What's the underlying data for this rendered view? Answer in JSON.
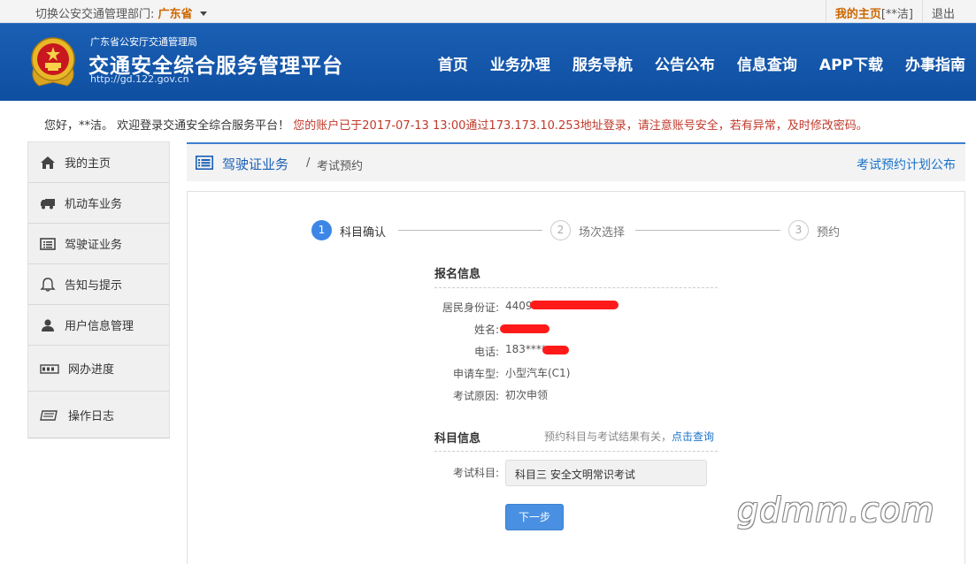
{
  "topbar": {
    "dept_label": "切换公安交通管理部门:",
    "dept_value": "广东省",
    "my_home": "我的主页",
    "user_masked": "[**洁]",
    "logout": "退出"
  },
  "header": {
    "org": "广东省公安厅交通管理局",
    "title": "交通安全综合服务管理平台",
    "url": "http://gd.122.gov.cn",
    "nav": [
      "首页",
      "业务办理",
      "服务导航",
      "公告公布",
      "信息查询",
      "APP下载",
      "办事指南"
    ]
  },
  "welcome": {
    "greeting": "您好，**洁。 欢迎登录交通安全综合服务平台！",
    "warning": "您的账户已于2017-07-13 13:00通过173.173.10.253地址登录，请注意账号安全，若有异常，及时修改密码。"
  },
  "sidebar": {
    "items": [
      {
        "label": "我的主页",
        "icon": "home-icon"
      },
      {
        "label": "机动车业务",
        "icon": "truck-icon"
      },
      {
        "label": "驾驶证业务",
        "icon": "license-card-icon"
      },
      {
        "label": "告知与提示",
        "icon": "bell-icon"
      },
      {
        "label": "用户信息管理",
        "icon": "user-icon"
      },
      {
        "label": "网办进度",
        "icon": "progress-icon"
      },
      {
        "label": "操作日志",
        "icon": "log-icon"
      }
    ]
  },
  "breadcrumb": {
    "section": "驾驶证业务",
    "separator": "/",
    "page": "考试预约",
    "plan_link": "考试预约计划公布"
  },
  "steps": [
    {
      "num": "1",
      "label": "科目确认",
      "active": true
    },
    {
      "num": "2",
      "label": "场次选择",
      "active": false
    },
    {
      "num": "3",
      "label": "预约",
      "active": false
    }
  ],
  "registration": {
    "title": "报名信息",
    "fields": [
      {
        "label": "居民身份证:",
        "value": "4409"
      },
      {
        "label": "姓名:",
        "value": ""
      },
      {
        "label": "电话:",
        "value": "183****"
      },
      {
        "label": "申请车型:",
        "value": "小型汽车(C1)"
      },
      {
        "label": "考试原因:",
        "value": "初次申领"
      }
    ]
  },
  "subject": {
    "title": "科目信息",
    "hint": "预约科目与考试结果有关，",
    "hint_link": "点击查询",
    "label": "考试科目:",
    "value": "科目三 安全文明常识考试",
    "next_button": "下一步"
  },
  "watermark": "gdmm.com",
  "colors": {
    "header_blue": "#1a5fb4",
    "accent_blue": "#3d86e6",
    "warning_red": "#c0392b",
    "highlight_orange": "#cc6600"
  }
}
